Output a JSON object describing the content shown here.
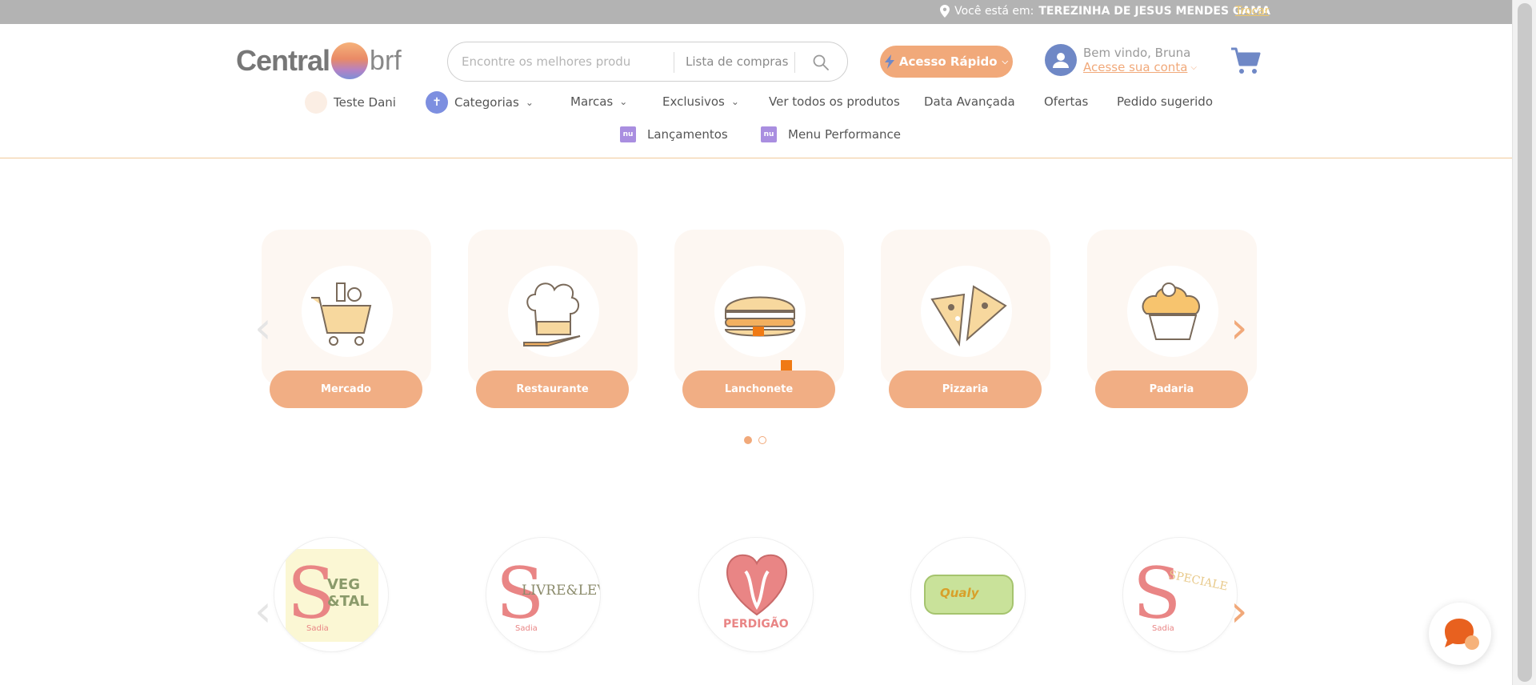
{
  "topbar": {
    "location_prefix": "Você está em:",
    "location_name": "TEREZINHA DE JESUS MENDES GAMA",
    "change_link": "Trocar"
  },
  "logo": {
    "part1": "Central",
    "part2": "brf"
  },
  "search": {
    "placeholder": "Encontre os melhores produtos para",
    "list_label": "Lista de compras"
  },
  "quick_access": {
    "label": "Acesso Rápido"
  },
  "account": {
    "welcome": "Bem vindo, Bruna",
    "link": "Acesse sua conta"
  },
  "nav": {
    "row1": [
      {
        "label": "Teste Dani"
      },
      {
        "label": "Categorias"
      },
      {
        "label": "Marcas"
      },
      {
        "label": "Exclusivos"
      },
      {
        "label": "Ver todos os produtos"
      },
      {
        "label": "Data Avançada"
      },
      {
        "label": "Ofertas"
      },
      {
        "label": "Pedido sugerido"
      }
    ],
    "row2": [
      {
        "label": "Lançamentos",
        "icon_text": "nu"
      },
      {
        "label": "Menu Performance",
        "icon_text": "nu"
      }
    ]
  },
  "categories": [
    {
      "label": "Mercado",
      "icon": "shopping-cart-icon"
    },
    {
      "label": "Restaurante",
      "icon": "chef-hat-icon"
    },
    {
      "label": "Lanchonete",
      "icon": "burger-icon"
    },
    {
      "label": "Pizzaria",
      "icon": "pizza-icon"
    },
    {
      "label": "Padaria",
      "icon": "cupcake-icon"
    }
  ],
  "brands": [
    {
      "name": "Sadia Veg&Tal",
      "logo_text": "VEG &TAL",
      "sub": "Sadia"
    },
    {
      "name": "Sadia Livre&Lev",
      "logo_text": "LIVRE&LEV",
      "sub": "Sadia"
    },
    {
      "name": "Perdigão",
      "logo_text": "PERDIGÃO"
    },
    {
      "name": "Qualy",
      "logo_text": "Qualy"
    },
    {
      "name": "Sadia Speciale",
      "logo_text": "SPECIALE",
      "sub": "Sadia"
    }
  ],
  "colors": {
    "accent": "#f1a97a",
    "pill": "#f1ae84",
    "topbar": "#b3b3b3",
    "avatar": "#6f88c6",
    "nav_icon": "#a98ee0"
  }
}
